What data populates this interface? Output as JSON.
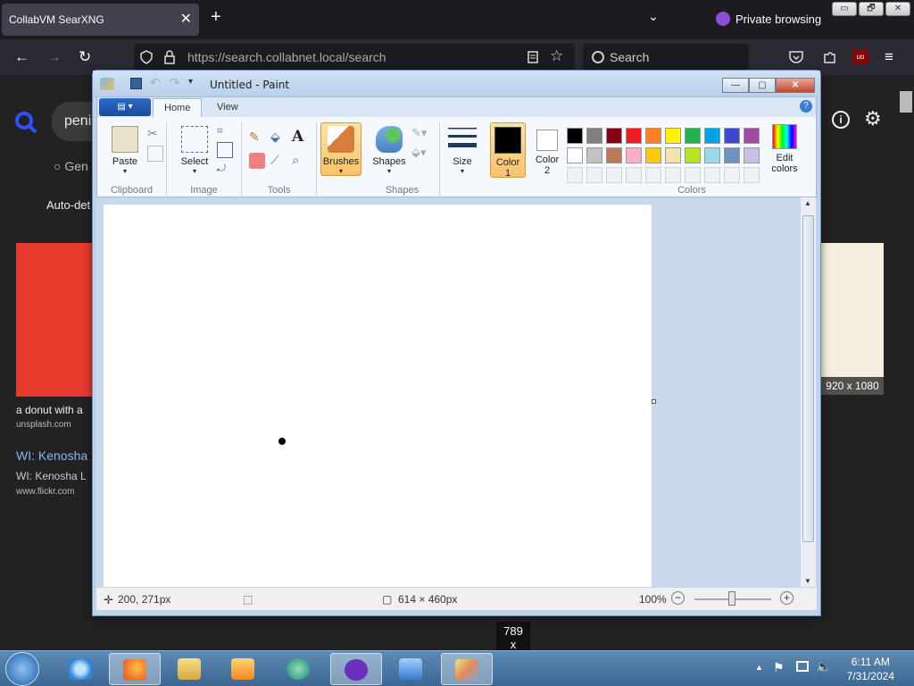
{
  "browser": {
    "tab_title": "CollabVM SearXNG",
    "tab_close": "✕",
    "new_tab": "+",
    "tab_list": "⌄",
    "private_label": "Private browsing",
    "url_host": "https://search.collabnet.local/search",
    "search_placeholder": "Search",
    "nav": {
      "back": "←",
      "forward": "→",
      "reload": "↻",
      "menu": "≡"
    },
    "window_controls": [
      "▭",
      "🗗",
      "✕"
    ]
  },
  "page": {
    "query": "peni",
    "tab_general": "Gen",
    "auto_detect": "Auto-det",
    "result1_title": "a donut with a",
    "result1_source": "unsplash.com",
    "result2_link": "WI: Kenosha",
    "result2_title": "WI: Kenosha L",
    "result2_source": "www.flickr.com",
    "image_size": "920 x 1080"
  },
  "paint": {
    "title": "Untitled - Paint",
    "tabs": [
      "Home",
      "View"
    ],
    "groups": {
      "clipboard": {
        "label": "Clipboard",
        "paste": "Paste"
      },
      "image": {
        "label": "Image",
        "select": "Select"
      },
      "tools": {
        "label": "Tools"
      },
      "brushes": {
        "label": "Brushes"
      },
      "shapes": {
        "label": "Shapes",
        "button": "Shapes"
      },
      "size": {
        "label": "Size"
      },
      "color1": {
        "label": "Color",
        "num": "1",
        "value": "#000000"
      },
      "color2": {
        "label": "Color",
        "num": "2",
        "value": "#ffffff"
      },
      "colors": {
        "label": "Colors",
        "edit": "Edit",
        "edit2": "colors"
      }
    },
    "palette": [
      "#000000",
      "#7f7f7f",
      "#880015",
      "#ed1c24",
      "#ff7f27",
      "#fff200",
      "#22b14c",
      "#00a2e8",
      "#3f48cc",
      "#a349a4",
      "#ffffff",
      "#c3c3c3",
      "#b97a57",
      "#ffaec9",
      "#ffc90e",
      "#efe4b0",
      "#b5e61d",
      "#99d9ea",
      "#7092be",
      "#c8bfe7"
    ],
    "status": {
      "position": "200, 271px",
      "canvas_size": "614 × 460px",
      "zoom": "100%"
    }
  },
  "tooltip": {
    "line1": "789",
    "line2": "x"
  },
  "taskbar": {
    "time": "6:11 AM",
    "date": "7/31/2024"
  }
}
